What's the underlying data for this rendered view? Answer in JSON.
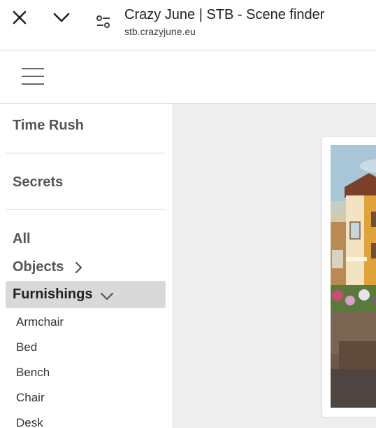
{
  "browser": {
    "title": "Crazy June | STB - Scene finder",
    "url": "stb.crazyjune.eu",
    "icons": [
      "close-icon",
      "chevron-down-icon",
      "site-settings-icon"
    ]
  },
  "header": {
    "menu_icon": "hamburger-menu-icon"
  },
  "sidebar": {
    "sections": [
      {
        "label": "Time Rush"
      },
      {
        "label": "Secrets"
      }
    ],
    "categories": [
      {
        "label": "All"
      },
      {
        "label": "Objects",
        "icon": "chevron-right-icon"
      },
      {
        "label": "Furnishings",
        "icon": "chevron-down-icon",
        "active": true
      }
    ],
    "subitems": [
      {
        "label": "Armchair"
      },
      {
        "label": "Bed"
      },
      {
        "label": "Bench"
      },
      {
        "label": "Chair"
      },
      {
        "label": "Desk"
      }
    ]
  },
  "main": {
    "scene_image": "scene-preview-image"
  },
  "colors": {
    "active_category_bg": "#d9d9d9",
    "main_bg": "#eeeeee",
    "sidebar_text": "#555555"
  }
}
